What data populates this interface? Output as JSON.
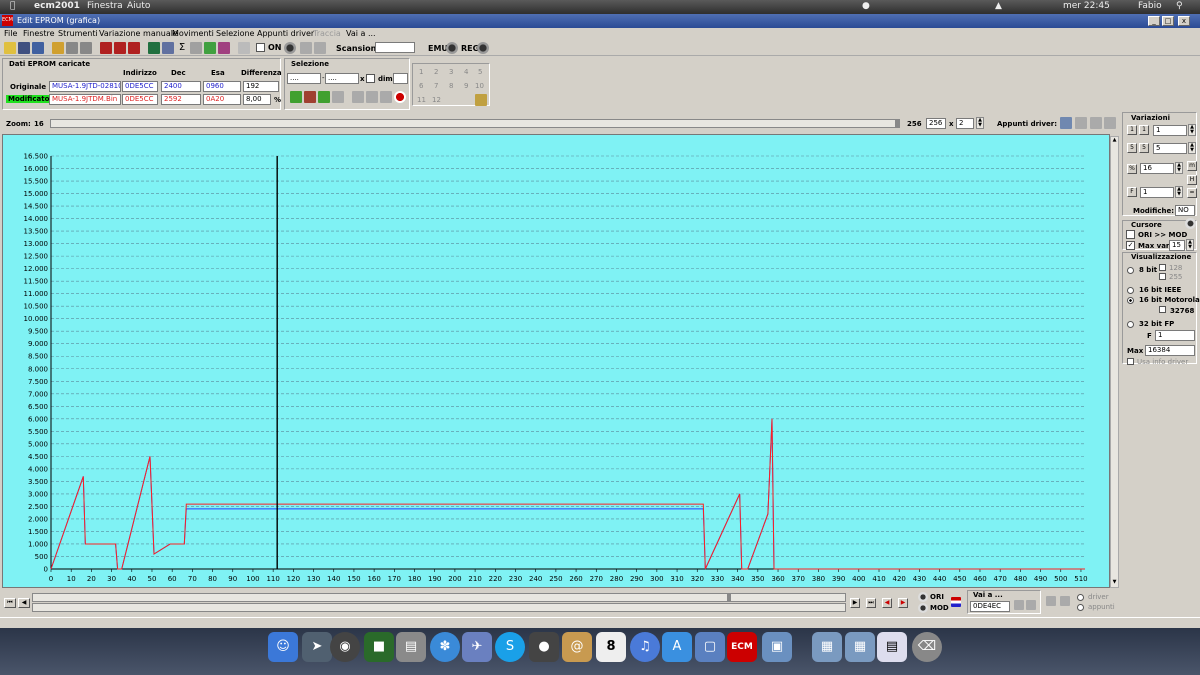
{
  "macmenu": {
    "app": "ecm2001",
    "items": [
      "Finestra",
      "Aiuto"
    ],
    "clock": "mer 22:45",
    "user": "Fabio"
  },
  "window": {
    "title": "Edit EPROM (grafica)"
  },
  "menu": [
    "File",
    "Finestre",
    "Strumenti",
    "Variazione manuale",
    "Movimenti",
    "Selezione",
    "Appunti driver",
    "Traccia",
    "Vai a ..."
  ],
  "toolbar": {
    "on_label": "ON",
    "scan_label": "Scansione",
    "emu_label": "EMU",
    "reg_label": "REG"
  },
  "eprom": {
    "group_title": "Dati EPROM caricate",
    "headers": {
      "indirizzo": "Indirizzo",
      "dec": "Dec",
      "esa": "Esa",
      "diff": "Differenza"
    },
    "original": {
      "label": "Originale",
      "file": "MUSA-1.9JTD-028101",
      "addr": "0DE5CC",
      "dec": "2400",
      "hex": "0960",
      "diff": "192"
    },
    "modified": {
      "label": "Modificato",
      "file": "MUSA-1.9JTDM.Bin",
      "addr": "0DE5CC",
      "dec": "2592",
      "hex": "0A20",
      "diff": "8,00",
      "unit": "%"
    }
  },
  "selezione": {
    "title": "Selezione",
    "f1": "....",
    "f2": "....",
    "x": "x",
    "dim": "dim."
  },
  "numgrid": [
    "1",
    "2",
    "3",
    "4",
    "5",
    "6",
    "7",
    "8",
    "9",
    "10",
    "11",
    "12"
  ],
  "zoom": {
    "label": "Zoom:",
    "min": "16",
    "max": "256",
    "value": "256",
    "mult_label": "x",
    "mult": "2",
    "appunti": "Appunti driver:"
  },
  "variazioni": {
    "title": "Variazioni",
    "v1": "1",
    "v2": "5",
    "v3": "16",
    "v4": "1",
    "mod_label": "Modifiche:",
    "mod_value": "NO"
  },
  "cursore": {
    "title": "Cursore",
    "ori_mod": "ORI >> MOD",
    "maxvar_label": "Max var",
    "maxvar": "15"
  },
  "visual": {
    "title": "Visualizzazione",
    "opt8": "8 bit",
    "v128": "128",
    "v255": "255",
    "opt16ieee": "16 bit IEEE",
    "opt16mot": "16 bit Motorola",
    "v32768": "32768",
    "opt32": "32 bit FP",
    "f_label": "F",
    "f_value": "1",
    "max_label": "Max",
    "max_value": "16384",
    "usa": "Usa info driver"
  },
  "bottom": {
    "ori": "ORI",
    "mod": "MOD",
    "vai_label": "Vai a ...",
    "vai_value": "0DE4EC",
    "driver": "driver",
    "appunti": "appunti"
  },
  "colors": {
    "chart_bg": "#7ff2f4",
    "orig": "#2244ff",
    "mod": "#ff2020",
    "cursor": "#000000"
  },
  "chart_data": {
    "type": "line",
    "xlim": [
      0,
      512
    ],
    "ylim": [
      0,
      16500
    ],
    "xticks": [
      0,
      10,
      20,
      30,
      40,
      50,
      60,
      70,
      80,
      90,
      100,
      110,
      120,
      130,
      140,
      150,
      160,
      170,
      180,
      190,
      200,
      210,
      220,
      230,
      240,
      250,
      260,
      270,
      280,
      290,
      300,
      310,
      320,
      330,
      340,
      350,
      360,
      370,
      380,
      390,
      400,
      410,
      420,
      430,
      440,
      450,
      460,
      470,
      480,
      490,
      500,
      510
    ],
    "yticks": [
      "0",
      "500",
      "1.000",
      "1.500",
      "2.000",
      "2.500",
      "3.000",
      "3.500",
      "4.000",
      "4.500",
      "5.000",
      "5.500",
      "6.000",
      "6.500",
      "7.000",
      "7.500",
      "8.000",
      "8.500",
      "9.000",
      "9.500",
      "10.000",
      "10.500",
      "11.000",
      "11.500",
      "12.000",
      "12.500",
      "13.000",
      "13.500",
      "14.000",
      "14.500",
      "15.000",
      "15.500",
      "16.000",
      "16.500"
    ],
    "cursor_x": 112,
    "grid": true,
    "series": [
      {
        "points": [
          [
            0,
            0
          ],
          [
            16,
            3700
          ],
          [
            17,
            1000
          ],
          [
            32,
            1000
          ],
          [
            33,
            0
          ],
          [
            35,
            0
          ],
          [
            49,
            4500
          ],
          [
            51,
            600
          ],
          [
            59,
            1000
          ],
          [
            66,
            1000
          ],
          [
            67,
            2400
          ],
          [
            323,
            2400
          ],
          [
            324,
            0
          ],
          [
            341,
            3000
          ],
          [
            342,
            0
          ],
          [
            345,
            0
          ],
          [
            355,
            2200
          ],
          [
            357,
            6000
          ],
          [
            358,
            0
          ],
          [
            512,
            0
          ]
        ]
      },
      {
        "points": [
          [
            0,
            0
          ],
          [
            16,
            3700
          ],
          [
            17,
            1000
          ],
          [
            32,
            1000
          ],
          [
            33,
            0
          ],
          [
            35,
            0
          ],
          [
            49,
            4500
          ],
          [
            51,
            600
          ],
          [
            59,
            1000
          ],
          [
            66,
            1000
          ],
          [
            67,
            2592
          ],
          [
            323,
            2592
          ],
          [
            324,
            0
          ],
          [
            341,
            3000
          ],
          [
            342,
            0
          ],
          [
            345,
            0
          ],
          [
            355,
            2200
          ],
          [
            357,
            6000
          ],
          [
            358,
            0
          ],
          [
            512,
            0
          ]
        ]
      }
    ]
  }
}
